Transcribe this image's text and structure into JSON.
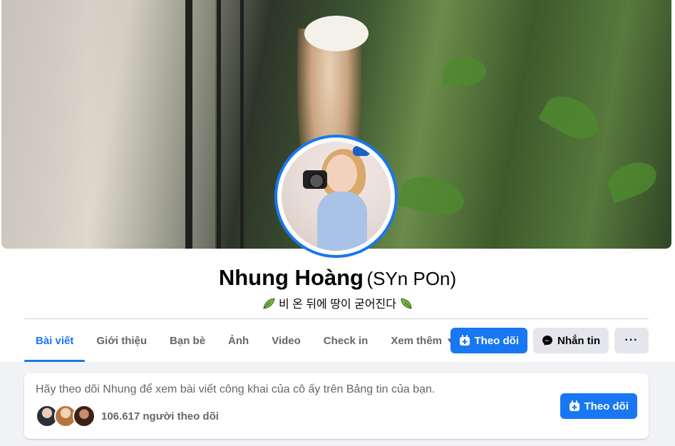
{
  "profile": {
    "name": "Nhung Hoàng",
    "alt_name": "(SYn POn)",
    "bio": "비 온 뒤에 땅이 굳어진다"
  },
  "tabs": [
    {
      "label": "Bài viết",
      "active": true
    },
    {
      "label": "Giới thiệu",
      "active": false
    },
    {
      "label": "Bạn bè",
      "active": false
    },
    {
      "label": "Ảnh",
      "active": false
    },
    {
      "label": "Video",
      "active": false
    },
    {
      "label": "Check in",
      "active": false
    },
    {
      "label": "Xem thêm",
      "active": false
    }
  ],
  "actions": {
    "follow_label": "Theo dõi",
    "message_label": "Nhắn tin",
    "more_label": "···"
  },
  "follow_card": {
    "text": "Hãy theo dõi Nhung để xem bài viết công khai của cô ấy trên Bảng tin của bạn.",
    "follower_count": "106.617 người theo dõi",
    "follow_label": "Theo dõi"
  },
  "colors": {
    "accent": "#1877f2",
    "secondary_text": "#65676b",
    "background": "#f0f2f5"
  },
  "icons": {
    "follow": "follow-plus-icon",
    "message": "messenger-icon",
    "more": "more-dots-icon",
    "bio": "sprout-icon",
    "tab_more": "caret-down-icon"
  }
}
